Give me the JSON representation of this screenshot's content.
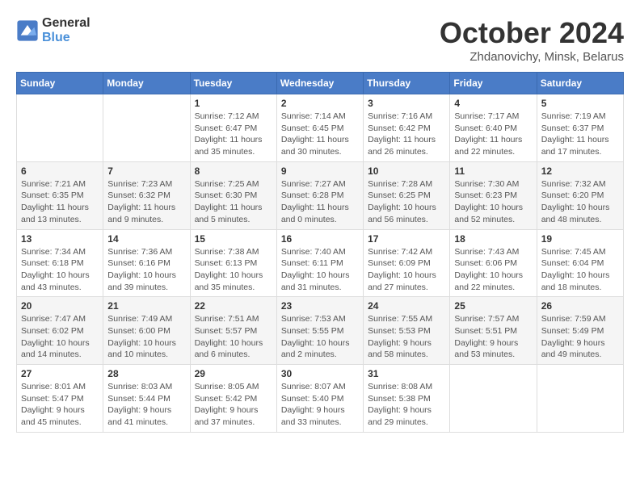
{
  "header": {
    "logo_general": "General",
    "logo_blue": "Blue",
    "month_title": "October 2024",
    "subtitle": "Zhdanovichy, Minsk, Belarus"
  },
  "weekdays": [
    "Sunday",
    "Monday",
    "Tuesday",
    "Wednesday",
    "Thursday",
    "Friday",
    "Saturday"
  ],
  "weeks": [
    [
      {
        "day": "",
        "info": ""
      },
      {
        "day": "",
        "info": ""
      },
      {
        "day": "1",
        "info": "Sunrise: 7:12 AM\nSunset: 6:47 PM\nDaylight: 11 hours and 35 minutes."
      },
      {
        "day": "2",
        "info": "Sunrise: 7:14 AM\nSunset: 6:45 PM\nDaylight: 11 hours and 30 minutes."
      },
      {
        "day": "3",
        "info": "Sunrise: 7:16 AM\nSunset: 6:42 PM\nDaylight: 11 hours and 26 minutes."
      },
      {
        "day": "4",
        "info": "Sunrise: 7:17 AM\nSunset: 6:40 PM\nDaylight: 11 hours and 22 minutes."
      },
      {
        "day": "5",
        "info": "Sunrise: 7:19 AM\nSunset: 6:37 PM\nDaylight: 11 hours and 17 minutes."
      }
    ],
    [
      {
        "day": "6",
        "info": "Sunrise: 7:21 AM\nSunset: 6:35 PM\nDaylight: 11 hours and 13 minutes."
      },
      {
        "day": "7",
        "info": "Sunrise: 7:23 AM\nSunset: 6:32 PM\nDaylight: 11 hours and 9 minutes."
      },
      {
        "day": "8",
        "info": "Sunrise: 7:25 AM\nSunset: 6:30 PM\nDaylight: 11 hours and 5 minutes."
      },
      {
        "day": "9",
        "info": "Sunrise: 7:27 AM\nSunset: 6:28 PM\nDaylight: 11 hours and 0 minutes."
      },
      {
        "day": "10",
        "info": "Sunrise: 7:28 AM\nSunset: 6:25 PM\nDaylight: 10 hours and 56 minutes."
      },
      {
        "day": "11",
        "info": "Sunrise: 7:30 AM\nSunset: 6:23 PM\nDaylight: 10 hours and 52 minutes."
      },
      {
        "day": "12",
        "info": "Sunrise: 7:32 AM\nSunset: 6:20 PM\nDaylight: 10 hours and 48 minutes."
      }
    ],
    [
      {
        "day": "13",
        "info": "Sunrise: 7:34 AM\nSunset: 6:18 PM\nDaylight: 10 hours and 43 minutes."
      },
      {
        "day": "14",
        "info": "Sunrise: 7:36 AM\nSunset: 6:16 PM\nDaylight: 10 hours and 39 minutes."
      },
      {
        "day": "15",
        "info": "Sunrise: 7:38 AM\nSunset: 6:13 PM\nDaylight: 10 hours and 35 minutes."
      },
      {
        "day": "16",
        "info": "Sunrise: 7:40 AM\nSunset: 6:11 PM\nDaylight: 10 hours and 31 minutes."
      },
      {
        "day": "17",
        "info": "Sunrise: 7:42 AM\nSunset: 6:09 PM\nDaylight: 10 hours and 27 minutes."
      },
      {
        "day": "18",
        "info": "Sunrise: 7:43 AM\nSunset: 6:06 PM\nDaylight: 10 hours and 22 minutes."
      },
      {
        "day": "19",
        "info": "Sunrise: 7:45 AM\nSunset: 6:04 PM\nDaylight: 10 hours and 18 minutes."
      }
    ],
    [
      {
        "day": "20",
        "info": "Sunrise: 7:47 AM\nSunset: 6:02 PM\nDaylight: 10 hours and 14 minutes."
      },
      {
        "day": "21",
        "info": "Sunrise: 7:49 AM\nSunset: 6:00 PM\nDaylight: 10 hours and 10 minutes."
      },
      {
        "day": "22",
        "info": "Sunrise: 7:51 AM\nSunset: 5:57 PM\nDaylight: 10 hours and 6 minutes."
      },
      {
        "day": "23",
        "info": "Sunrise: 7:53 AM\nSunset: 5:55 PM\nDaylight: 10 hours and 2 minutes."
      },
      {
        "day": "24",
        "info": "Sunrise: 7:55 AM\nSunset: 5:53 PM\nDaylight: 9 hours and 58 minutes."
      },
      {
        "day": "25",
        "info": "Sunrise: 7:57 AM\nSunset: 5:51 PM\nDaylight: 9 hours and 53 minutes."
      },
      {
        "day": "26",
        "info": "Sunrise: 7:59 AM\nSunset: 5:49 PM\nDaylight: 9 hours and 49 minutes."
      }
    ],
    [
      {
        "day": "27",
        "info": "Sunrise: 8:01 AM\nSunset: 5:47 PM\nDaylight: 9 hours and 45 minutes."
      },
      {
        "day": "28",
        "info": "Sunrise: 8:03 AM\nSunset: 5:44 PM\nDaylight: 9 hours and 41 minutes."
      },
      {
        "day": "29",
        "info": "Sunrise: 8:05 AM\nSunset: 5:42 PM\nDaylight: 9 hours and 37 minutes."
      },
      {
        "day": "30",
        "info": "Sunrise: 8:07 AM\nSunset: 5:40 PM\nDaylight: 9 hours and 33 minutes."
      },
      {
        "day": "31",
        "info": "Sunrise: 8:08 AM\nSunset: 5:38 PM\nDaylight: 9 hours and 29 minutes."
      },
      {
        "day": "",
        "info": ""
      },
      {
        "day": "",
        "info": ""
      }
    ]
  ]
}
